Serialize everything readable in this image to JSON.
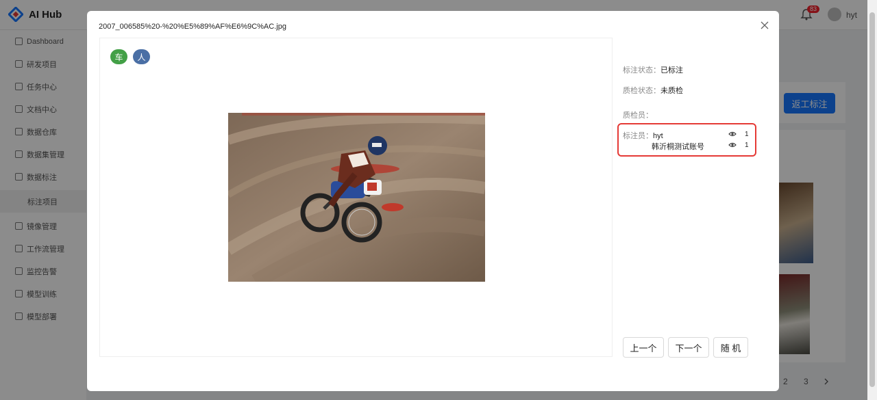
{
  "app": {
    "name": "AI Hub",
    "brand_color": "#1677ff"
  },
  "header": {
    "notification_count": "83",
    "user_name": "hyt"
  },
  "sidebar": {
    "items": [
      {
        "label": "Dashboard",
        "icon": "dashboard-icon"
      },
      {
        "label": "研发项目",
        "icon": "folder-icon"
      },
      {
        "label": "任务中心",
        "icon": "task-icon"
      },
      {
        "label": "文档中心",
        "icon": "document-icon"
      },
      {
        "label": "数据仓库",
        "icon": "home-icon"
      },
      {
        "label": "数据集管理",
        "icon": "database-icon"
      },
      {
        "label": "数据标注",
        "icon": "pen-icon"
      },
      {
        "label": "标注项目",
        "icon": ""
      },
      {
        "label": "镜像管理",
        "icon": "image-icon"
      },
      {
        "label": "工作流管理",
        "icon": "workflow-icon"
      },
      {
        "label": "监控告警",
        "icon": "warning-icon"
      },
      {
        "label": "模型训练",
        "icon": "training-icon"
      },
      {
        "label": "模型部署",
        "icon": "deploy-icon"
      }
    ]
  },
  "background": {
    "action_button": "返工标注",
    "pagination": [
      "2",
      "3"
    ]
  },
  "modal": {
    "title": "2007_006585%20-%20%E5%89%AF%E6%9C%AC.jpg",
    "tags": [
      {
        "label": "车",
        "color": "#43a047"
      },
      {
        "label": "人",
        "color": "#4a6fa5"
      }
    ],
    "label_status": {
      "key": "标注状态：",
      "value": "已标注"
    },
    "qc_status": {
      "key": "质检状态：",
      "value": "未质检"
    },
    "qc_person": {
      "key": "质检员：",
      "value": ""
    },
    "annotators": {
      "key": "标注员：",
      "list": [
        {
          "name": "hyt",
          "count": "1"
        },
        {
          "name": "韩沂桐测试账号",
          "count": "1"
        }
      ],
      "highlight_color": "#e53935"
    },
    "buttons": {
      "prev": "上一个",
      "next": "下一个",
      "random": "随 机"
    }
  }
}
